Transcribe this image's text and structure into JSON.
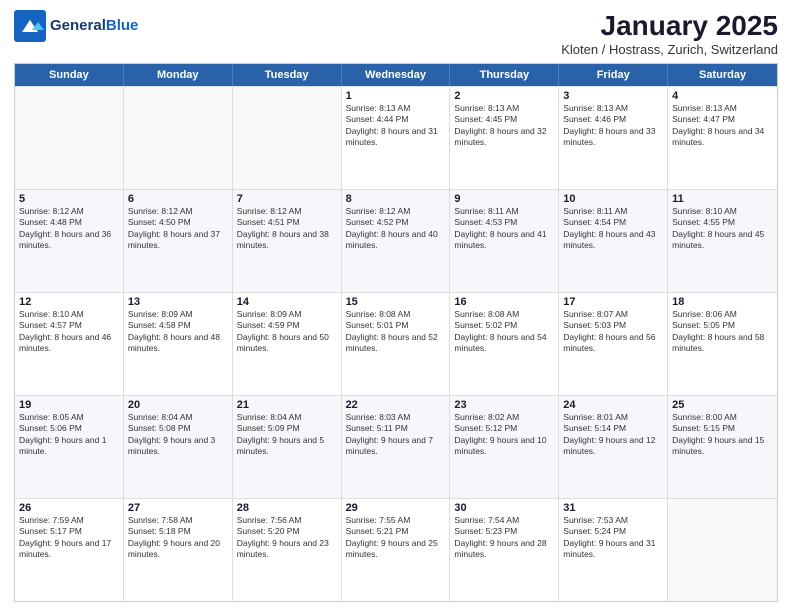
{
  "header": {
    "logo_general": "General",
    "logo_blue": "Blue",
    "month_title": "January 2025",
    "subtitle": "Kloten / Hostrass, Zurich, Switzerland"
  },
  "days_of_week": [
    "Sunday",
    "Monday",
    "Tuesday",
    "Wednesday",
    "Thursday",
    "Friday",
    "Saturday"
  ],
  "weeks": [
    [
      {
        "day": "",
        "empty": true
      },
      {
        "day": "",
        "empty": true
      },
      {
        "day": "",
        "empty": true
      },
      {
        "day": "1",
        "sunrise": "8:13 AM",
        "sunset": "4:44 PM",
        "daylight": "8 hours and 31 minutes."
      },
      {
        "day": "2",
        "sunrise": "8:13 AM",
        "sunset": "4:45 PM",
        "daylight": "8 hours and 32 minutes."
      },
      {
        "day": "3",
        "sunrise": "8:13 AM",
        "sunset": "4:46 PM",
        "daylight": "8 hours and 33 minutes."
      },
      {
        "day": "4",
        "sunrise": "8:13 AM",
        "sunset": "4:47 PM",
        "daylight": "8 hours and 34 minutes."
      }
    ],
    [
      {
        "day": "5",
        "sunrise": "8:12 AM",
        "sunset": "4:48 PM",
        "daylight": "8 hours and 36 minutes."
      },
      {
        "day": "6",
        "sunrise": "8:12 AM",
        "sunset": "4:50 PM",
        "daylight": "8 hours and 37 minutes."
      },
      {
        "day": "7",
        "sunrise": "8:12 AM",
        "sunset": "4:51 PM",
        "daylight": "8 hours and 38 minutes."
      },
      {
        "day": "8",
        "sunrise": "8:12 AM",
        "sunset": "4:52 PM",
        "daylight": "8 hours and 40 minutes."
      },
      {
        "day": "9",
        "sunrise": "8:11 AM",
        "sunset": "4:53 PM",
        "daylight": "8 hours and 41 minutes."
      },
      {
        "day": "10",
        "sunrise": "8:11 AM",
        "sunset": "4:54 PM",
        "daylight": "8 hours and 43 minutes."
      },
      {
        "day": "11",
        "sunrise": "8:10 AM",
        "sunset": "4:55 PM",
        "daylight": "8 hours and 45 minutes."
      }
    ],
    [
      {
        "day": "12",
        "sunrise": "8:10 AM",
        "sunset": "4:57 PM",
        "daylight": "8 hours and 46 minutes."
      },
      {
        "day": "13",
        "sunrise": "8:09 AM",
        "sunset": "4:58 PM",
        "daylight": "8 hours and 48 minutes."
      },
      {
        "day": "14",
        "sunrise": "8:09 AM",
        "sunset": "4:59 PM",
        "daylight": "8 hours and 50 minutes."
      },
      {
        "day": "15",
        "sunrise": "8:08 AM",
        "sunset": "5:01 PM",
        "daylight": "8 hours and 52 minutes."
      },
      {
        "day": "16",
        "sunrise": "8:08 AM",
        "sunset": "5:02 PM",
        "daylight": "8 hours and 54 minutes."
      },
      {
        "day": "17",
        "sunrise": "8:07 AM",
        "sunset": "5:03 PM",
        "daylight": "8 hours and 56 minutes."
      },
      {
        "day": "18",
        "sunrise": "8:06 AM",
        "sunset": "5:05 PM",
        "daylight": "8 hours and 58 minutes."
      }
    ],
    [
      {
        "day": "19",
        "sunrise": "8:05 AM",
        "sunset": "5:06 PM",
        "daylight": "9 hours and 1 minute."
      },
      {
        "day": "20",
        "sunrise": "8:04 AM",
        "sunset": "5:08 PM",
        "daylight": "9 hours and 3 minutes."
      },
      {
        "day": "21",
        "sunrise": "8:04 AM",
        "sunset": "5:09 PM",
        "daylight": "9 hours and 5 minutes."
      },
      {
        "day": "22",
        "sunrise": "8:03 AM",
        "sunset": "5:11 PM",
        "daylight": "9 hours and 7 minutes."
      },
      {
        "day": "23",
        "sunrise": "8:02 AM",
        "sunset": "5:12 PM",
        "daylight": "9 hours and 10 minutes."
      },
      {
        "day": "24",
        "sunrise": "8:01 AM",
        "sunset": "5:14 PM",
        "daylight": "9 hours and 12 minutes."
      },
      {
        "day": "25",
        "sunrise": "8:00 AM",
        "sunset": "5:15 PM",
        "daylight": "9 hours and 15 minutes."
      }
    ],
    [
      {
        "day": "26",
        "sunrise": "7:59 AM",
        "sunset": "5:17 PM",
        "daylight": "9 hours and 17 minutes."
      },
      {
        "day": "27",
        "sunrise": "7:58 AM",
        "sunset": "5:18 PM",
        "daylight": "9 hours and 20 minutes."
      },
      {
        "day": "28",
        "sunrise": "7:56 AM",
        "sunset": "5:20 PM",
        "daylight": "9 hours and 23 minutes."
      },
      {
        "day": "29",
        "sunrise": "7:55 AM",
        "sunset": "5:21 PM",
        "daylight": "9 hours and 25 minutes."
      },
      {
        "day": "30",
        "sunrise": "7:54 AM",
        "sunset": "5:23 PM",
        "daylight": "9 hours and 28 minutes."
      },
      {
        "day": "31",
        "sunrise": "7:53 AM",
        "sunset": "5:24 PM",
        "daylight": "9 hours and 31 minutes."
      },
      {
        "day": "",
        "empty": true
      }
    ]
  ],
  "labels": {
    "sunrise_prefix": "Sunrise: ",
    "sunset_prefix": "Sunset: ",
    "daylight_prefix": "Daylight: "
  }
}
